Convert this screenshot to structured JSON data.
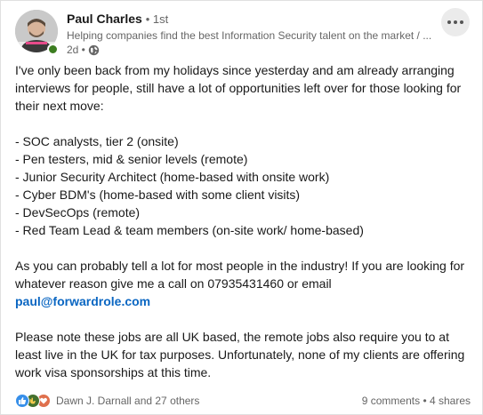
{
  "author": {
    "name": "Paul Charles",
    "degree": "• 1st",
    "headline": "Helping companies find the best Information Security talent on the market / ...",
    "time": "2d •",
    "online_color": "#3c7d20"
  },
  "icons": {
    "more": "more-options-icon",
    "visibility": "globe-icon",
    "reactions": [
      "like-icon",
      "celebrate-icon",
      "love-icon"
    ]
  },
  "post": {
    "intro": "I've only been back from my holidays since yesterday and am already arranging interviews for people, still have a lot of opportunities left over for those looking for their next move:",
    "roles": [
      "- SOC analysts, tier 2 (onsite)",
      "- Pen testers, mid & senior levels (remote)",
      "- Junior Security Architect (home-based with onsite work)",
      "- Cyber BDM's (home-based with some client visits)",
      "- DevSecOps (remote)",
      "- Red Team Lead & team members (on-site work/ home-based)"
    ],
    "contact_text": "As you can probably tell a lot for most people in the industry! If you are looking for whatever reason give me a call on 07935431460 or email",
    "email": "paul@forwardrole.com",
    "note": "Please note these jobs are all UK based, the remote jobs also require you to at least live in the UK for tax purposes. Unfortunately, none of my clients are offering work visa sponsorships at this time."
  },
  "social": {
    "reactors": "Dawn J. Darnall and 27 others",
    "counts": "9 comments • 4 shares"
  },
  "colors": {
    "link": "#0a66c2",
    "like": "#378fe9",
    "celebrate": "#44712e",
    "love": "#df704d"
  }
}
